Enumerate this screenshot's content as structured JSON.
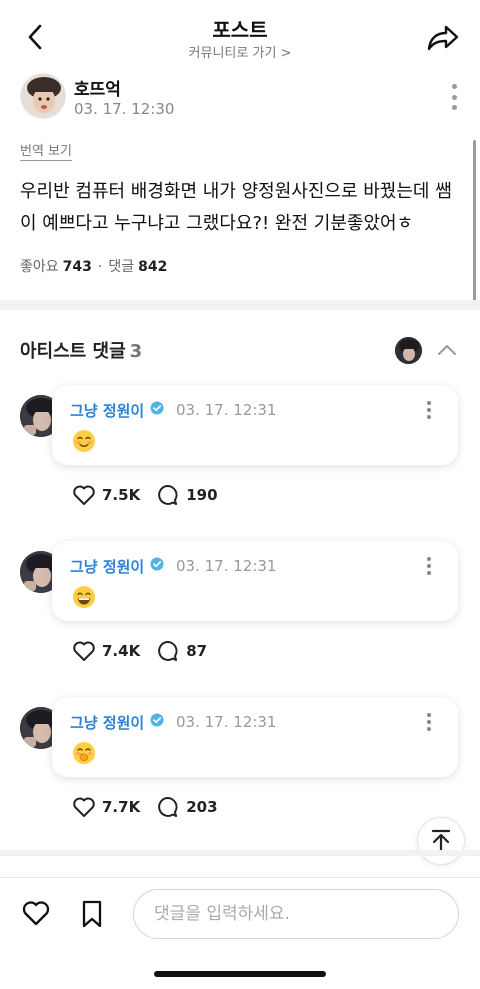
{
  "header": {
    "title": "포스트",
    "community_link": "커뮤니티로 가기 >"
  },
  "post": {
    "author": "호뜨억",
    "time": "03. 17. 12:30",
    "translate_label": "번역 보기",
    "body": "우리반 컴퓨터 배경화면 내가 양정원사진으로 바꿨는데 쌤이 예쁘다고 누구냐고 그랬다요?! 완전 기분좋았어ㅎ",
    "likes_label": "좋아요",
    "likes_count": "743",
    "separator": "·",
    "comments_label": "댓글",
    "comments_count": "842"
  },
  "artist_comments": {
    "title": "아티스트 댓글",
    "count": "3",
    "items": [
      {
        "name": "그냥 정원이",
        "time": "03. 17. 12:31",
        "emoji": "smiling-face-emoji",
        "likes": "7.5K",
        "replies": "190"
      },
      {
        "name": "그냥 정원이",
        "time": "03. 17. 12:31",
        "emoji": "grinning-face-emoji",
        "likes": "7.4K",
        "replies": "87"
      },
      {
        "name": "그냥 정원이",
        "time": "03. 17. 12:31",
        "emoji": "hand-over-mouth-emoji",
        "likes": "7.7K",
        "replies": "203"
      }
    ]
  },
  "comment_input": {
    "placeholder": "댓글을 입력하세요."
  },
  "icons": {
    "back": "chevron-left-icon",
    "share": "share-arrow-icon",
    "more": "vertical-dots-icon",
    "verified": "verified-badge-icon",
    "collapse": "chevron-up-icon",
    "like": "heart-icon",
    "reply": "speech-bubble-icon",
    "scroll_top": "arrow-to-top-icon",
    "bookmark": "bookmark-icon"
  },
  "colors": {
    "artist_name": "#2d82d6",
    "verified_badge": "#4fb3e6",
    "muted_text": "#888888"
  }
}
